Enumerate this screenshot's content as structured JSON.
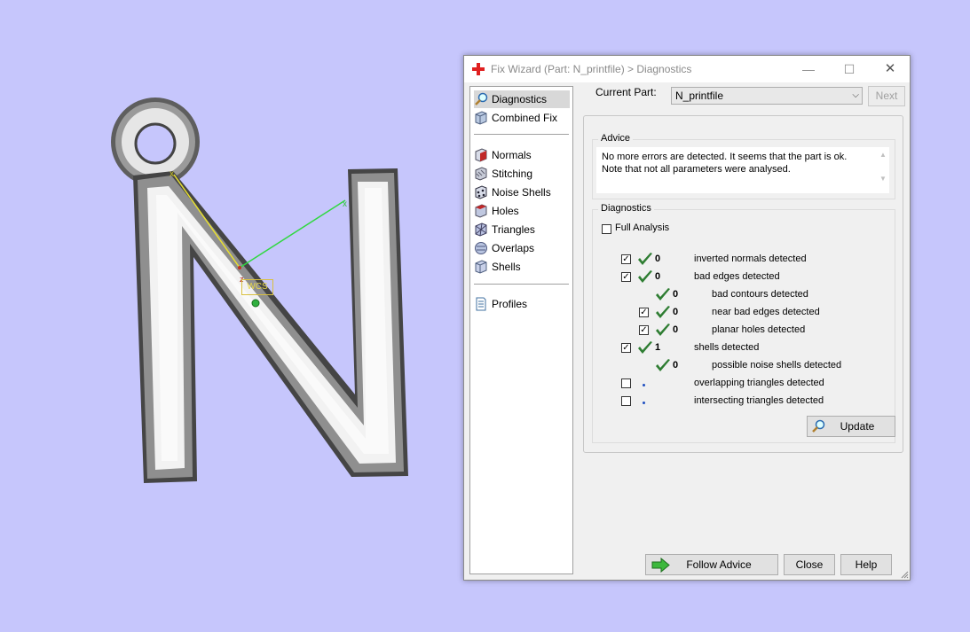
{
  "viewport": {
    "wcs_label": "WCS"
  },
  "dialog": {
    "title": "Fix Wizard (Part: N_printfile) > Diagnostics",
    "controls": {
      "minimize": "—",
      "maximize": "☐",
      "close": "✕"
    }
  },
  "nav": {
    "items": [
      {
        "label": "Diagnostics",
        "icon": "magnifier-icon",
        "active": true
      },
      {
        "label": "Combined Fix",
        "icon": "cube-icon"
      },
      {
        "label": "Normals",
        "icon": "normals-cube-icon"
      },
      {
        "label": "Stitching",
        "icon": "stitching-cube-icon"
      },
      {
        "label": "Noise Shells",
        "icon": "noise-shells-icon"
      },
      {
        "label": "Holes",
        "icon": "holes-cube-icon"
      },
      {
        "label": "Triangles",
        "icon": "triangles-icon"
      },
      {
        "label": "Overlaps",
        "icon": "overlaps-icon"
      },
      {
        "label": "Shells",
        "icon": "shells-cube-icon"
      },
      {
        "label": "Profiles",
        "icon": "document-icon"
      }
    ]
  },
  "current_part": {
    "label": "Current Part:",
    "value": "N_printfile"
  },
  "buttons": {
    "next": "Next",
    "update": "Update",
    "follow_advice": "Follow Advice",
    "close": "Close",
    "help": "Help"
  },
  "advice": {
    "title": "Advice",
    "line1": "No more errors are detected. It seems that the part is ok.",
    "line2": "Note that not all parameters were analysed."
  },
  "diagnostics": {
    "title": "Diagnostics",
    "full_analysis": "Full Analysis",
    "rows": [
      {
        "count": "0",
        "label": "inverted normals detected",
        "checked": true,
        "tick": true
      },
      {
        "count": "0",
        "label": "bad edges detected",
        "checked": true,
        "tick": true
      },
      {
        "count": "0",
        "label": "bad contours detected",
        "checkbox": false,
        "tick": true
      },
      {
        "count": "0",
        "label": "near bad edges detected",
        "checked": true,
        "tick": true
      },
      {
        "count": "0",
        "label": "planar holes detected",
        "checked": true,
        "tick": true
      },
      {
        "count": "1",
        "label": "shells detected",
        "checked": true,
        "tick": true
      },
      {
        "count": "0",
        "label": "possible noise shells detected",
        "checkbox": false,
        "tick": true
      },
      {
        "count": "",
        "label": "overlapping triangles detected",
        "checked": false,
        "tick": false
      },
      {
        "count": "",
        "label": "intersecting triangles detected",
        "checked": false,
        "tick": false
      }
    ]
  },
  "colors": {
    "background": "#c6c6fc",
    "tick": "#2e7d32",
    "x_axis": "#e8e030",
    "y_axis": "#30d840"
  }
}
